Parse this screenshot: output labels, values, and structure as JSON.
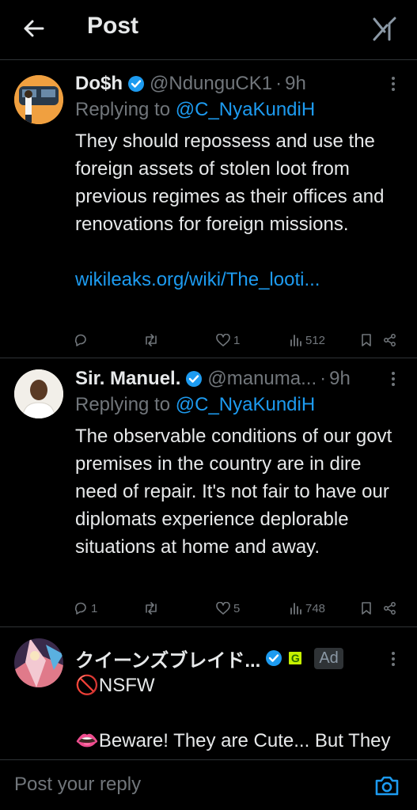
{
  "header": {
    "title": "Post",
    "back_icon": "arrow-left-icon",
    "grok_icon": "grok-icon"
  },
  "posts": [
    {
      "display_name": "Do$h",
      "handle": "@NdunguCK1",
      "separator": "·",
      "time": "9h",
      "replying_prefix": "Replying to",
      "replying_to": "@C_NyaKundiH",
      "text": "They should repossess and use the foreign assets of stolen loot from previous regimes as their offices and renovations for foreign missions.",
      "link": "wikileaks.org/wiki/The_looti...",
      "likes": "1",
      "views": "512"
    },
    {
      "display_name": "Sir. Manuel.",
      "handle": "@manuma...",
      "separator": "·",
      "time": "9h",
      "replying_prefix": "Replying to",
      "replying_to": "@C_NyaKundiH",
      "text": "The observable conditions of our govt premises in the country are in dire need of repair. It's not fair to have our diplomats experience deplorable situations at home and away.",
      "replies": "1",
      "likes": "5",
      "views": "748"
    },
    {
      "display_name": "クイーンズブレイド...",
      "affiliate_badge": "G",
      "ad_label": "Ad",
      "line1": "🚫NSFW",
      "line2": "👄Beware! They are Cute... But They Pack a Punch!"
    }
  ],
  "composer": {
    "placeholder": "Post your reply",
    "camera_icon": "camera-icon"
  },
  "colors": {
    "background": "#000000",
    "text": "#e7e9ea",
    "muted": "#71767b",
    "accent": "#1d9bf0",
    "divider": "#2f3336"
  }
}
